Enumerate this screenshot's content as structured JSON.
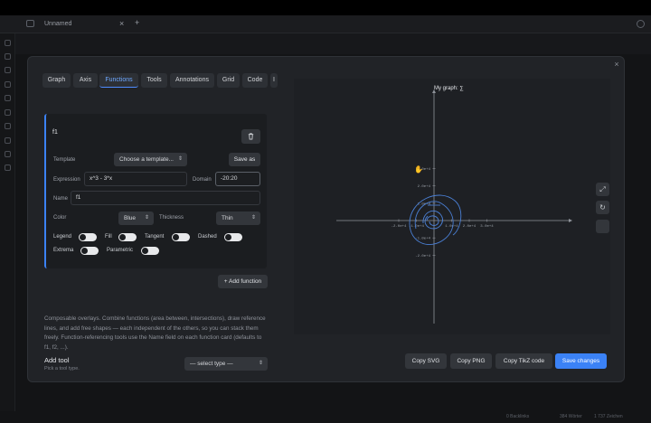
{
  "window": {
    "tab_title": "Unnamed",
    "tab_close": "×",
    "tab_add": "+"
  },
  "modal": {
    "close": "×",
    "tabs": [
      {
        "label": "Graph"
      },
      {
        "label": "Axis"
      },
      {
        "label": "Functions",
        "active": true
      },
      {
        "label": "Tools"
      },
      {
        "label": "Annotations"
      },
      {
        "label": "Grid"
      },
      {
        "label": "Code"
      },
      {
        "label": "I"
      }
    ],
    "function_card": {
      "name_heading": "f1",
      "template_label": "Template",
      "template_select": "Choose a template...",
      "save_as": "Save as",
      "expression_label": "Expression",
      "expression_value": "x^3 - 3*x",
      "domain_label": "Domain",
      "domain_value": "-20:20",
      "name_label": "Name",
      "name_value": "f1",
      "color_label": "Color",
      "color_value": "Blue",
      "thickness_label": "Thickness",
      "thickness_value": "Thin",
      "toggles": {
        "legend": "Legend",
        "fill": "Fill",
        "tangent": "Tangent",
        "dashed": "Dashed",
        "extrema": "Extrema",
        "parametric": "Parametric"
      }
    },
    "add_function": "+ Add function",
    "description": "Composable overlays. Combine functions (area between, intersections), draw reference lines, and add free shapes — each independent of the others, so you can stack them freely. Function-referencing tools use the Name field on each function card (defaults to f1, f2, ...).",
    "add_tool": {
      "title": "Add tool",
      "hint": "Pick a tool type.",
      "select": "— select type —"
    },
    "buttons": {
      "copy_svg": "Copy SVG",
      "copy_png": "Copy PNG",
      "copy_tikz": "Copy TikZ code",
      "save": "Save changes"
    }
  },
  "chart_data": {
    "type": "line",
    "title": "My graph: ∑",
    "xlabel": "",
    "ylabel": "",
    "xlim": [
      -40000.0,
      40000.0
    ],
    "ylim": [
      -30000.0,
      40000.0
    ],
    "xticks": [
      "-2.0e+4",
      "-1.0e+4",
      "1.0e+4",
      "2.0e+4",
      "3.0e+4"
    ],
    "yticks": [
      "3.0e+4",
      "2.0e+4",
      "1.0e+4",
      "-1.0e+4",
      "-2.0e+4"
    ],
    "series_color": "#4a7fd4",
    "grid": false
  },
  "statusbar": {
    "left": "0 Backlinks",
    "words": "384 Wörter",
    "chars": "1 737 Zeichen"
  },
  "colors": {
    "accent": "#3b82f6",
    "tab_active_text": "#6ea8ff"
  }
}
